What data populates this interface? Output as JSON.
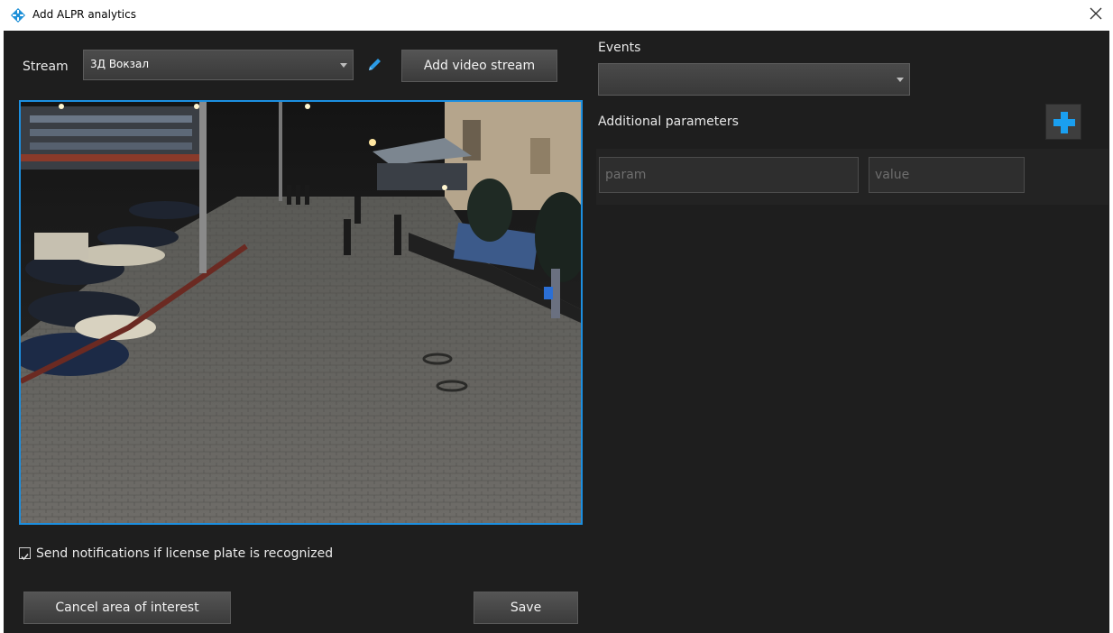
{
  "window": {
    "title": "Add ALPR analytics",
    "close_icon": "close-icon",
    "app_icon": "diamond-crosshair-icon"
  },
  "stream": {
    "label": "Stream",
    "selected": "3Д Вокзал",
    "edit_icon": "pencil-icon",
    "add_button": "Add video stream"
  },
  "video": {
    "description_icon": "camera-preview",
    "selection_border_color": "#1c8fe0"
  },
  "notifications": {
    "checked": true,
    "label": "Send notifications if license plate is recognized"
  },
  "buttons": {
    "cancel_area": "Cancel area of interest",
    "save": "Save"
  },
  "events": {
    "label": "Events",
    "selected": ""
  },
  "additional_parameters": {
    "label": "Additional parameters",
    "add_icon": "plus-icon",
    "param_placeholder": "param",
    "value_placeholder": "value"
  },
  "colors": {
    "background": "#1e1e1e",
    "accent": "#1c8fe0"
  }
}
